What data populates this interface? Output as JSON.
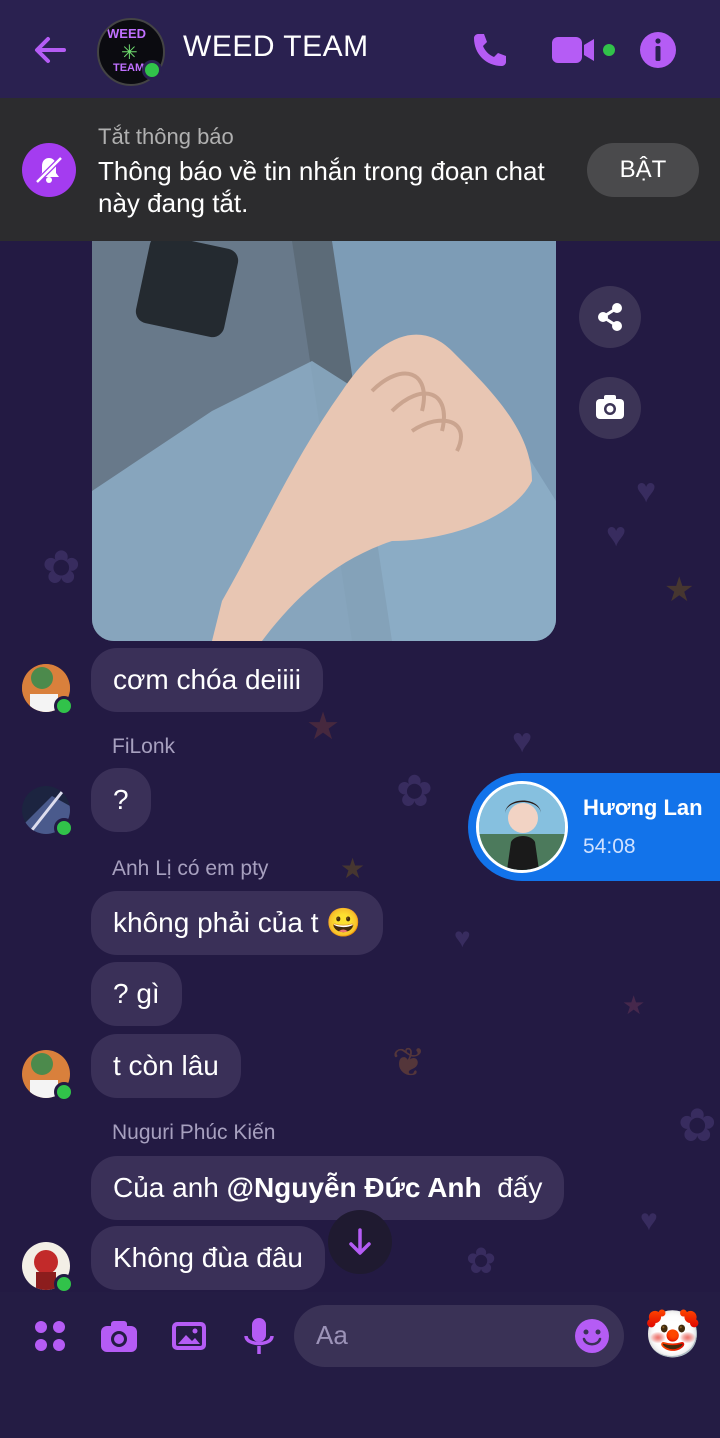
{
  "header": {
    "title": "WEED TEAM",
    "avatar_text": [
      "WEED",
      "TEAM"
    ]
  },
  "notice": {
    "label": "Tắt thông báo",
    "message": "Thông báo về tin nhắn trong đoạn chat này đang tắt.",
    "button": "BẬT"
  },
  "messages": [
    {
      "text": "cơm chóa deiiii"
    },
    {
      "sender": "FiLonk",
      "text": "?"
    },
    {
      "sender": "Anh Lị có em pty",
      "text": "không phải của t 😀"
    },
    {
      "text": "? gì"
    },
    {
      "text": "t còn lâu"
    },
    {
      "sender": "Nuguri Phúc Kiến",
      "prefix": "Của anh ",
      "mention": "@Nguyễn Đức Anh",
      "suffix": "  đấy"
    },
    {
      "text": "Không đùa đâu"
    }
  ],
  "call": {
    "name": "Hương Lan",
    "duration": "54:08"
  },
  "composer": {
    "placeholder": "Aa",
    "emoji": "🤡"
  },
  "colors": {
    "accent": "#a43cf0",
    "background": "#231a43",
    "bubble": "#3a3058",
    "call_card": "#1273ea",
    "online": "#31c24a"
  },
  "icons": [
    "back-arrow-icon",
    "phone-icon",
    "video-icon",
    "info-icon",
    "bell-off-icon",
    "share-icon",
    "camera-icon",
    "arrow-down-icon",
    "grid-icon",
    "image-icon",
    "mic-icon",
    "smile-icon"
  ]
}
